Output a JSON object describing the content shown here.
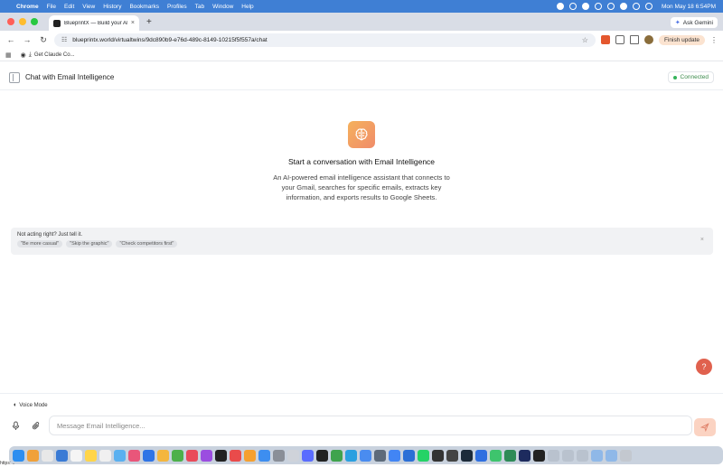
{
  "menubar": {
    "apple_glyph": "",
    "items": [
      "Chrome",
      "File",
      "Edit",
      "View",
      "History",
      "Bookmarks",
      "Profiles",
      "Tab",
      "Window",
      "Help"
    ],
    "clock": "Mon May 18  6:54PM"
  },
  "browser": {
    "tab_title": "BlueprintX — Build your AI d",
    "tab_close": "×",
    "new_tab": "+",
    "ask_gemini": "Ask Gemini",
    "url": "blueprintx.world/virtualtwins/9dc890b9-e76d-489c-8149-10215f5f557a/chat",
    "finish_update": "Finish update",
    "bookmark_item": "Get Claude Co..."
  },
  "app": {
    "title": "Chat with Email Intelligence",
    "status": "Connected"
  },
  "empty_state": {
    "title": "Start a conversation with Email Intelligence",
    "description": "An AI-powered email intelligence assistant that connects to your Gmail, searches for specific emails, extracts key information, and exports results to Google Sheets."
  },
  "feedback": {
    "title": "Not acting right? Just tell it.",
    "chips": [
      "\"Be more casual\"",
      "\"Skip the graphic\"",
      "\"Check competitors first\""
    ],
    "close": "×"
  },
  "help_glyph": "?",
  "composer": {
    "voice_mode": "Voice Mode",
    "placeholder": "Message Email Intelligence..."
  },
  "dock_status": "https:...",
  "colors": {
    "menubar": "#3f7fd4",
    "accent_orange": "#f08c6a",
    "connected_green": "#34b35a",
    "help_red": "#e0614e"
  },
  "icons": {
    "brain": "brain-icon",
    "send": "send-icon",
    "mic": "mic-icon",
    "attach": "paperclip-icon"
  }
}
